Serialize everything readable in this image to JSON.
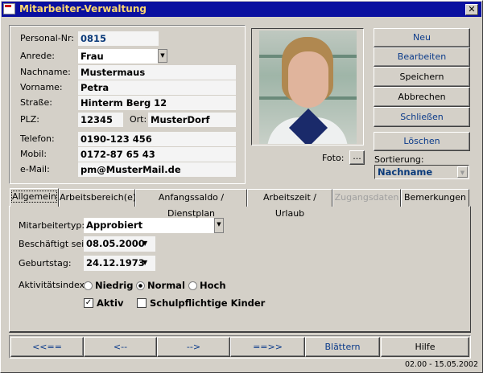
{
  "window": {
    "title": "Mitarbeiter-Verwaltung",
    "close": "✕"
  },
  "person": {
    "personal_nr_label": "Personal-Nr:",
    "personal_nr": "0815",
    "anrede_label": "Anrede:",
    "anrede": "Frau",
    "nachname_label": "Nachname:",
    "nachname": "Mustermaus",
    "vorname_label": "Vorname:",
    "vorname": "Petra",
    "strasse_label": "Straße:",
    "strasse": "Hinterm Berg 12",
    "plz_label": "PLZ:",
    "plz": "12345",
    "ort_label": "Ort:",
    "ort": "MusterDorf",
    "telefon_label": "Telefon:",
    "telefon": "0190-123 456",
    "mobil_label": "Mobil:",
    "mobil": "0172-87 65 43",
    "email_label": "e-Mail:",
    "email": "pm@MusterMail.de"
  },
  "photo": {
    "label": "Foto:",
    "browse": "..."
  },
  "actions": {
    "neu": "Neu",
    "bearbeiten": "Bearbeiten",
    "speichern": "Speichern",
    "abbrechen": "Abbrechen",
    "schliessen": "Schließen",
    "loeschen": "Löschen"
  },
  "sort": {
    "label": "Sortierung:",
    "value": "Nachname"
  },
  "tabs": [
    "Allgemein",
    "Arbeitsbereich(e)",
    "Anfangssaldo / Dienstplan",
    "Arbeitszeit / Urlaub",
    "Zugangsdaten",
    "Bemerkungen"
  ],
  "general": {
    "typ_label": "Mitarbeitertyp:",
    "typ": "Approbiert",
    "seit_label": "Beschäftigt seit:",
    "seit": "08.05.2000",
    "geburt_label": "Geburtstag:",
    "geburt": "24.12.1973",
    "aktiv_label": "Aktivitätsindex:",
    "radios": [
      "Niedrig",
      "Normal",
      "Hoch"
    ],
    "aktiv": "Aktiv",
    "kinder": "Schulpflichtige Kinder"
  },
  "nav": [
    "<<==",
    "<--",
    "-->",
    "==>>",
    "Blättern",
    "Hilfe"
  ],
  "footer": "02.00 - 15.05.2002"
}
